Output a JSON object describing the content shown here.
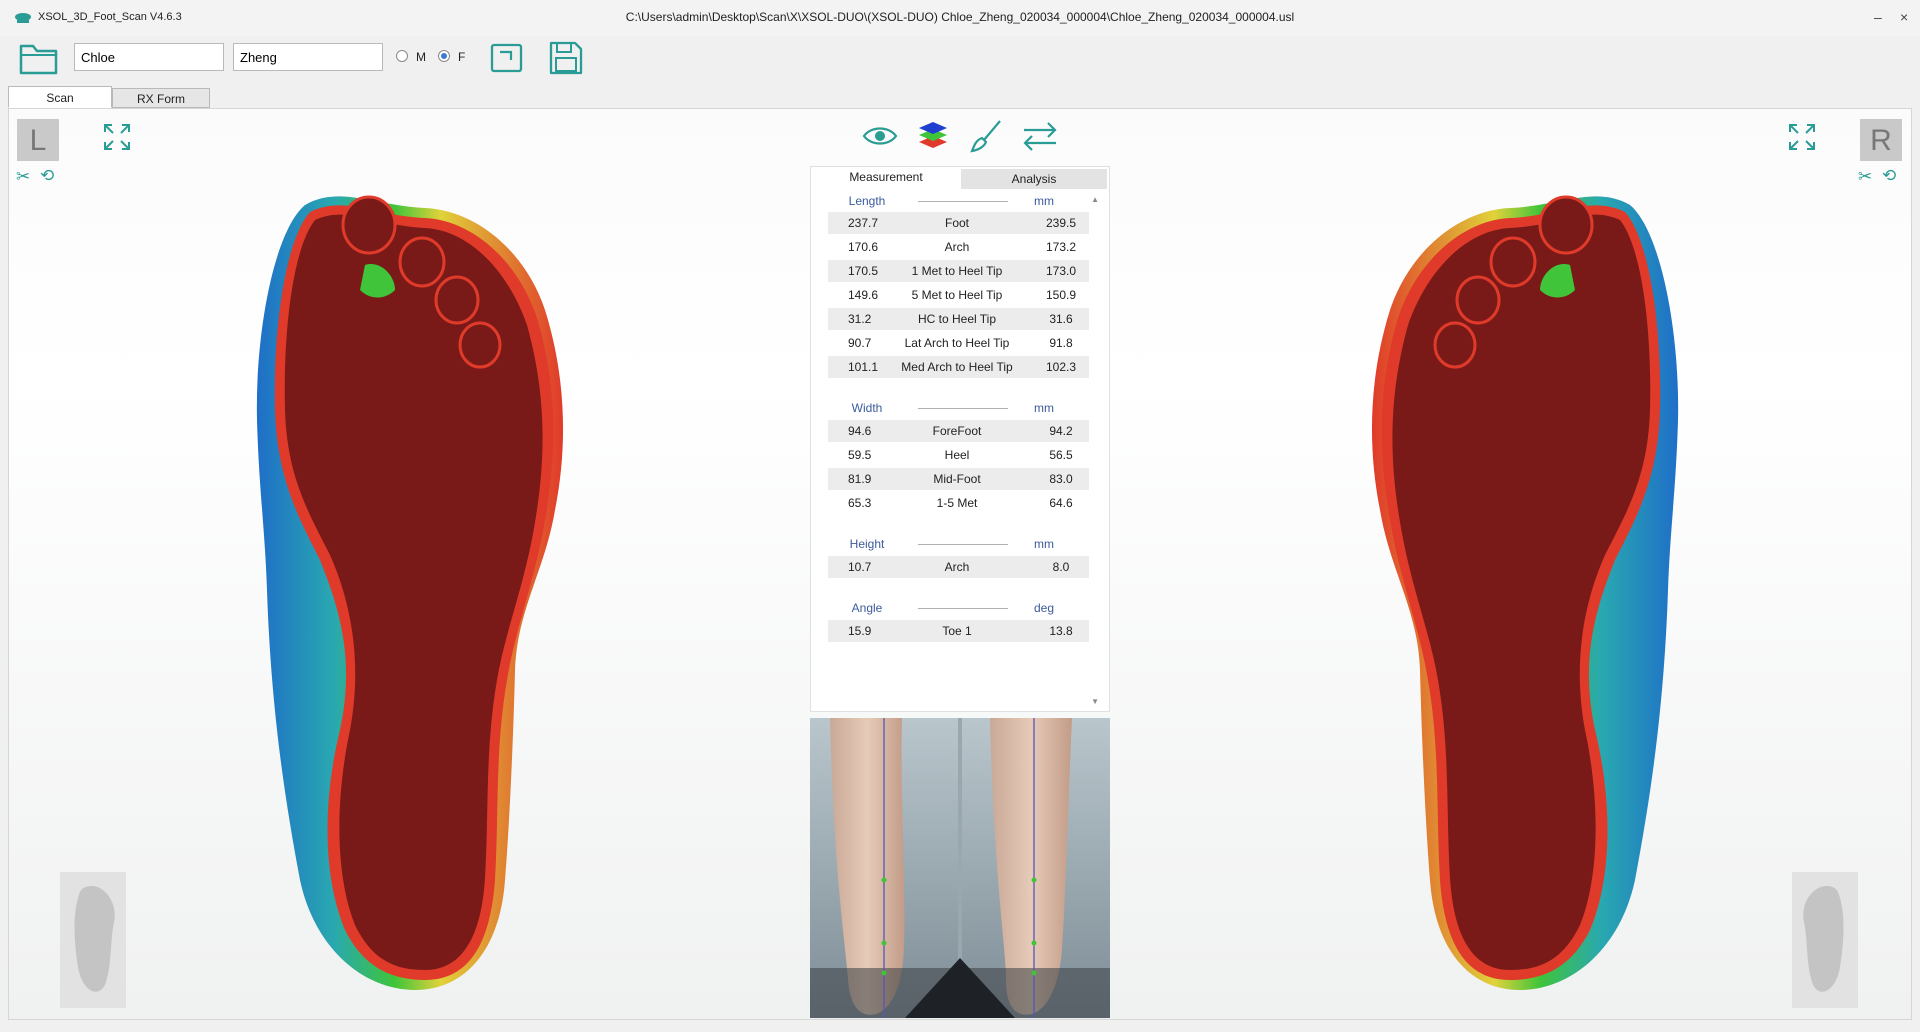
{
  "window": {
    "app_name": "XSOL_3D_Foot_Scan V4.6.3",
    "file_path": "C:\\Users\\admin\\Desktop\\Scan\\X\\XSOL-DUO\\(XSOL-DUO) Chloe_Zheng_020034_000004\\Chloe_Zheng_020034_000004.usl",
    "minimize_glyph": "–",
    "close_glyph": "×"
  },
  "toolbar": {
    "first_name": "Chloe",
    "last_name": "Zheng",
    "gender_options": [
      "M",
      "F"
    ],
    "gender_selected": "F",
    "icons": [
      "open-folder-icon",
      "export-icon",
      "save-icon"
    ]
  },
  "tabs": [
    {
      "label": "Scan",
      "active": true
    },
    {
      "label": "RX Form",
      "active": false
    }
  ],
  "left_side": {
    "label": "L",
    "tools": [
      "expand-icon",
      "scissors-icon",
      "rotate-icon"
    ]
  },
  "right_side": {
    "label": "R",
    "tools": [
      "expand-icon",
      "scissors-icon",
      "rotate-icon"
    ]
  },
  "center_icons": [
    "eye-icon",
    "layers-icon",
    "brush-icon",
    "swap-icon"
  ],
  "panel": {
    "tabs": [
      {
        "label": "Measurement",
        "active": true
      },
      {
        "label": "Analysis",
        "active": false
      }
    ],
    "sections": [
      {
        "title": "Length",
        "unit": "mm",
        "rows": [
          {
            "left": "237.7",
            "name": "Foot",
            "right": "239.5"
          },
          {
            "left": "170.6",
            "name": "Arch",
            "right": "173.2"
          },
          {
            "left": "170.5",
            "name": "1 Met to Heel Tip",
            "right": "173.0"
          },
          {
            "left": "149.6",
            "name": "5 Met to Heel Tip",
            "right": "150.9"
          },
          {
            "left": "31.2",
            "name": "HC to Heel Tip",
            "right": "31.6"
          },
          {
            "left": "90.7",
            "name": "Lat Arch to Heel Tip",
            "right": "91.8"
          },
          {
            "left": "101.1",
            "name": "Med Arch to Heel Tip",
            "right": "102.3"
          }
        ]
      },
      {
        "title": "Width",
        "unit": "mm",
        "rows": [
          {
            "left": "94.6",
            "name": "ForeFoot",
            "right": "94.2"
          },
          {
            "left": "59.5",
            "name": "Heel",
            "right": "56.5"
          },
          {
            "left": "81.9",
            "name": "Mid-Foot",
            "right": "83.0"
          },
          {
            "left": "65.3",
            "name": "1-5 Met",
            "right": "64.6"
          }
        ]
      },
      {
        "title": "Height",
        "unit": "mm",
        "rows": [
          {
            "left": "10.7",
            "name": "Arch",
            "right": "8.0"
          }
        ]
      },
      {
        "title": "Angle",
        "unit": "deg",
        "rows": [
          {
            "left": "15.9",
            "name": "Toe 1",
            "right": "13.8"
          }
        ]
      }
    ]
  },
  "colors": {
    "accent": "#2a9c96",
    "pressure_high": "#7a1a18",
    "pressure_edge": "#e03a2a",
    "pressure_mid": "#3fc43a",
    "pressure_low": "#1f6fc8",
    "section_title": "#3b5b9b"
  }
}
